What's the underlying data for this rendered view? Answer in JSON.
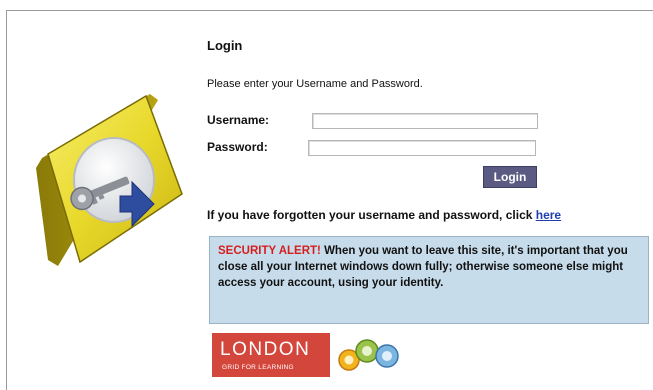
{
  "login": {
    "title": "Login",
    "instruction": "Please enter your Username and Password.",
    "username_label": "Username:",
    "password_label": "Password:",
    "username_value": "",
    "password_value": "",
    "button_label": "Login"
  },
  "forgot": {
    "text": "If you have forgotten your username and password, click ",
    "link_text": "here"
  },
  "alert": {
    "heading": "SECURITY ALERT!",
    "line_a": " When you want to leave this site, it's important that you close all your Internet windows down fully; otherwise someone else might access your account, using your identity."
  },
  "footer": {
    "brand": "LONDON",
    "tagline": "GRID FOR LEARNING"
  },
  "icons": {
    "logo": "key-arrow-icon",
    "footer_mark": "gfl-mark-icon"
  },
  "colors": {
    "login_button": "#5b5a83",
    "alert_bg": "#c7dcea",
    "alert_heading": "#d41f1f",
    "london_red": "#d3463c",
    "link": "#1f3fb0"
  }
}
